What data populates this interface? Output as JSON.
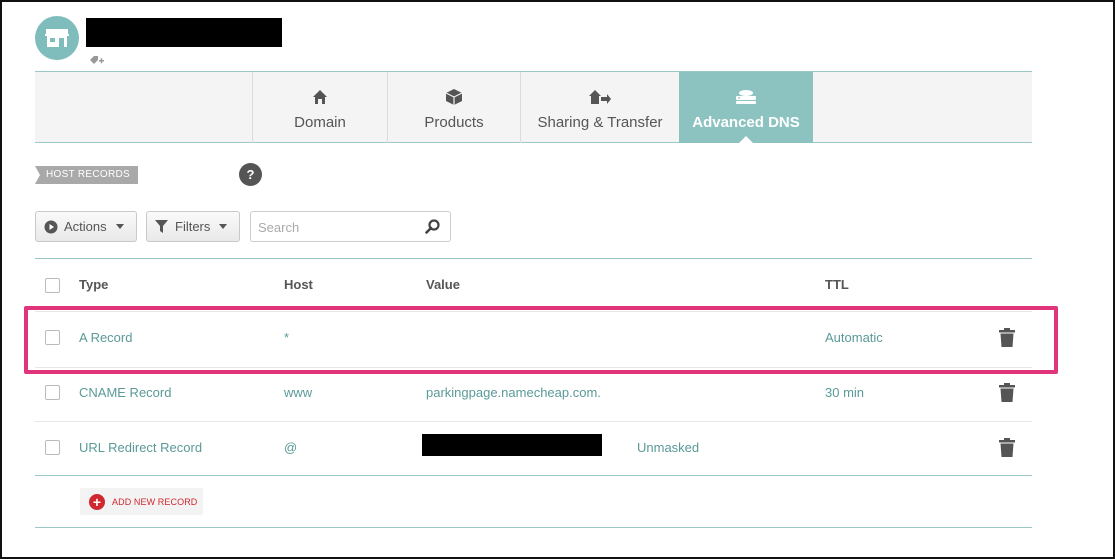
{
  "tabs": [
    {
      "label": "Domain",
      "icon": "home-icon"
    },
    {
      "label": "Products",
      "icon": "box-icon"
    },
    {
      "label": "Sharing & Transfer",
      "icon": "share-transfer-icon"
    },
    {
      "label": "Advanced DNS",
      "icon": "dns-server-icon",
      "active": true
    }
  ],
  "section": {
    "label": "HOST RECORDS",
    "help": "?"
  },
  "toolbar": {
    "actions_label": "Actions",
    "filters_label": "Filters",
    "search_placeholder": "Search"
  },
  "table": {
    "headers": {
      "type": "Type",
      "host": "Host",
      "value": "Value",
      "ttl": "TTL"
    },
    "rows": [
      {
        "type": "A Record",
        "host": "*",
        "value": "",
        "ttl": "Automatic",
        "highlighted": true
      },
      {
        "type": "CNAME Record",
        "host": "www",
        "value": "parkingpage.namecheap.com.",
        "ttl": "30 min"
      },
      {
        "type": "URL Redirect Record",
        "host": "@",
        "value": "",
        "value_note": "Unmasked",
        "ttl": ""
      }
    ]
  },
  "add_record_label": "ADD NEW RECORD",
  "colors": {
    "accent_teal": "#8cc3c0",
    "link_teal": "#5a9a98",
    "highlight_pink": "#e0357a",
    "add_red": "#d0282f"
  }
}
